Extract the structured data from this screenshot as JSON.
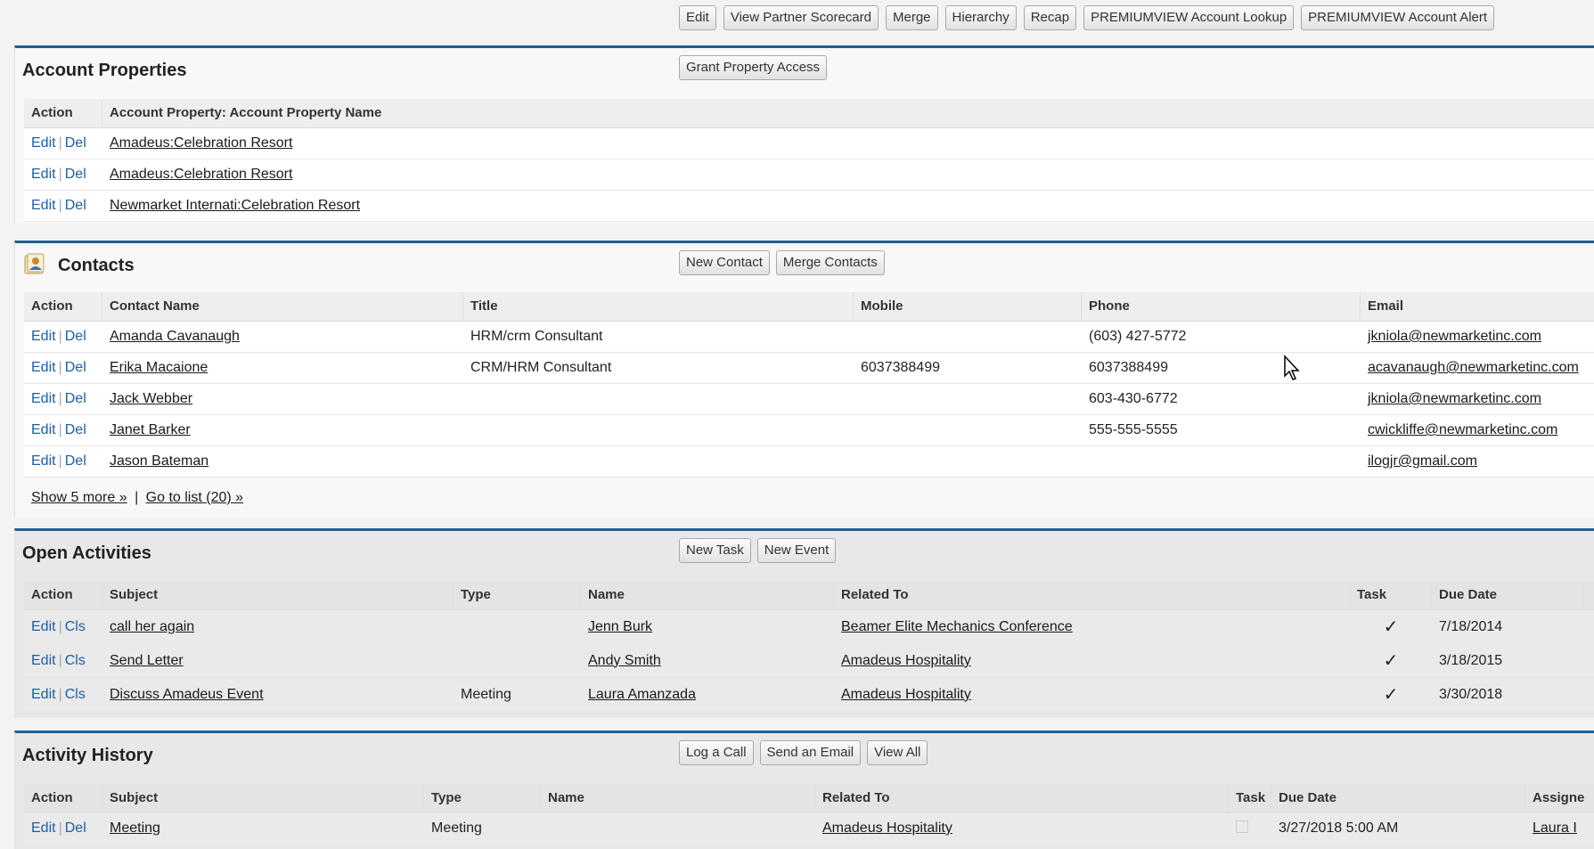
{
  "top_buttons": [
    "Edit",
    "View Partner Scorecard",
    "Merge",
    "Hierarchy",
    "Recap",
    "PREMIUMVIEW Account Lookup",
    "PREMIUMVIEW Account Alert"
  ],
  "account_properties": {
    "title": "Account Properties",
    "button": "Grant Property Access",
    "headers": [
      "Action",
      "Account Property: Account Property Name"
    ],
    "edit": "Edit",
    "del": "Del",
    "rows": [
      "Amadeus:Celebration Resort",
      "Amadeus:Celebration Resort",
      "Newmarket Internati:Celebration Resort"
    ]
  },
  "contacts": {
    "title": "Contacts",
    "buttons": [
      "New Contact",
      "Merge Contacts"
    ],
    "headers": [
      "Action",
      "Contact Name",
      "Title",
      "Mobile",
      "Phone",
      "Email"
    ],
    "edit": "Edit",
    "del": "Del",
    "rows": [
      {
        "name": "Amanda Cavanaugh",
        "title": "HRM/crm Consultant",
        "mobile": "",
        "phone": "(603) 427-5772",
        "email": "jkniola@newmarketinc.com"
      },
      {
        "name": "Erika Macaione",
        "title": "CRM/HRM Consultant",
        "mobile": "6037388499",
        "phone": "6037388499",
        "email": "acavanaugh@newmarketinc.com"
      },
      {
        "name": "Jack Webber",
        "title": "",
        "mobile": "",
        "phone": "603-430-6772",
        "email": "jkniola@newmarketinc.com"
      },
      {
        "name": "Janet Barker",
        "title": "",
        "mobile": "",
        "phone": "555-555-5555",
        "email": "cwickliffe@newmarketinc.com"
      },
      {
        "name": "Jason Bateman",
        "title": "",
        "mobile": "",
        "phone": "",
        "email": "ilogjr@gmail.com"
      }
    ],
    "show_more": "Show 5 more »",
    "separator": "|",
    "go_to_list": "Go to list (20) »"
  },
  "open_activities": {
    "title": "Open Activities",
    "buttons": [
      "New Task",
      "New Event"
    ],
    "headers": [
      "Action",
      "Subject",
      "Type",
      "Name",
      "Related To",
      "Task",
      "Due Date"
    ],
    "edit": "Edit",
    "cls": "Cls",
    "rows": [
      {
        "subject": "call her again",
        "type": "",
        "name": "Jenn Burk",
        "related": "Beamer Elite Mechanics Conference",
        "task": "✓",
        "due": "7/18/2014"
      },
      {
        "subject": "Send Letter",
        "type": "",
        "name": "Andy Smith",
        "related": "Amadeus Hospitality",
        "task": "✓",
        "due": "3/18/2015"
      },
      {
        "subject": "Discuss Amadeus Event",
        "type": "Meeting",
        "name": "Laura Amanzada",
        "related": "Amadeus Hospitality",
        "task": "✓",
        "due": "3/30/2018"
      }
    ]
  },
  "activity_history": {
    "title": "Activity History",
    "buttons": [
      "Log a Call",
      "Send an Email",
      "View All"
    ],
    "headers": [
      "Action",
      "Subject",
      "Type",
      "Name",
      "Related To",
      "Task",
      "Due Date",
      "Assigne"
    ],
    "edit": "Edit",
    "del": "Del",
    "rows": [
      {
        "subject": "Meeting",
        "type": "Meeting",
        "name": "",
        "related": "Amadeus Hospitality",
        "task": "",
        "due": "3/27/2018 5:00 AM",
        "assigned": "Laura I"
      }
    ]
  }
}
